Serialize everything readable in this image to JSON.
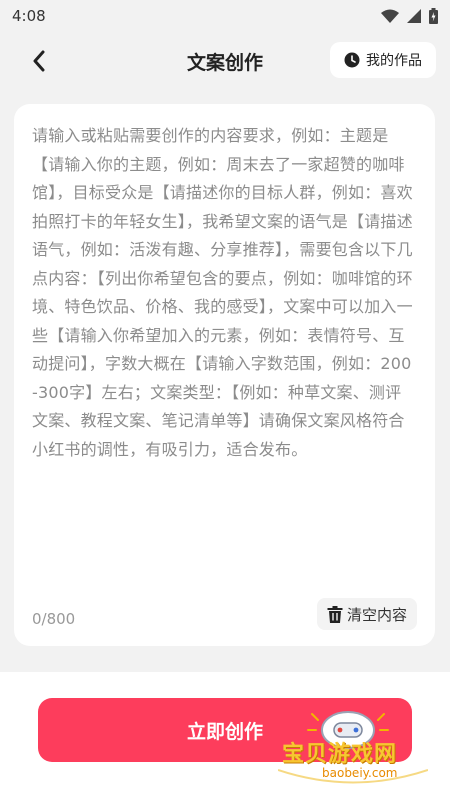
{
  "status_bar": {
    "time": "4:08"
  },
  "nav": {
    "title": "文案创作",
    "works_label": "我的作品"
  },
  "editor": {
    "placeholder": "请输入或粘贴需要创作的内容要求，例如：主题是【请输入你的主题，例如：周末去了一家超赞的咖啡馆】，目标受众是【请描述你的目标人群，例如：喜欢拍照打卡的年轻女生】，我希望文案的语气是【请描述语气，例如：活泼有趣、分享推荐】，需要包含以下几点内容：【列出你希望包含的要点，例如：咖啡馆的环境、特色饮品、价格、我的感受】，文案中可以加入一些【请输入你希望加入的元素，例如：表情符号、互动提问】，字数大概在【请输入字数范围，例如：200-300字】左右；文案类型：【例如：种草文案、测评文案、教程文案、笔记清单等】请确保文案风格符合小红书的调性，有吸引力，适合发布。",
    "char_count": "0/800",
    "clear_label": "清空内容"
  },
  "actions": {
    "create_label": "立即创作"
  },
  "watermark": {
    "text": "宝贝游戏网",
    "url": "baobeiy.com"
  },
  "colors": {
    "accent": "#fd3d5c",
    "background": "#f2f2f2"
  }
}
